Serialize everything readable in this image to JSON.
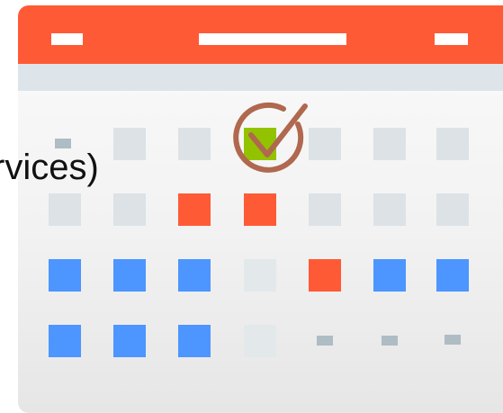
{
  "label": {
    "visible_text": "rvices)"
  },
  "colors": {
    "header": "#ff5a36",
    "subheader": "#dde4ea",
    "empty_day": "#dce2e6",
    "busy_day": "#ff5a36",
    "booked_day": "#4d95ff",
    "today": "#93c300",
    "checkmark": "#b0684e"
  },
  "icons": [
    "calendar-icon",
    "checkmark-circle-icon"
  ]
}
